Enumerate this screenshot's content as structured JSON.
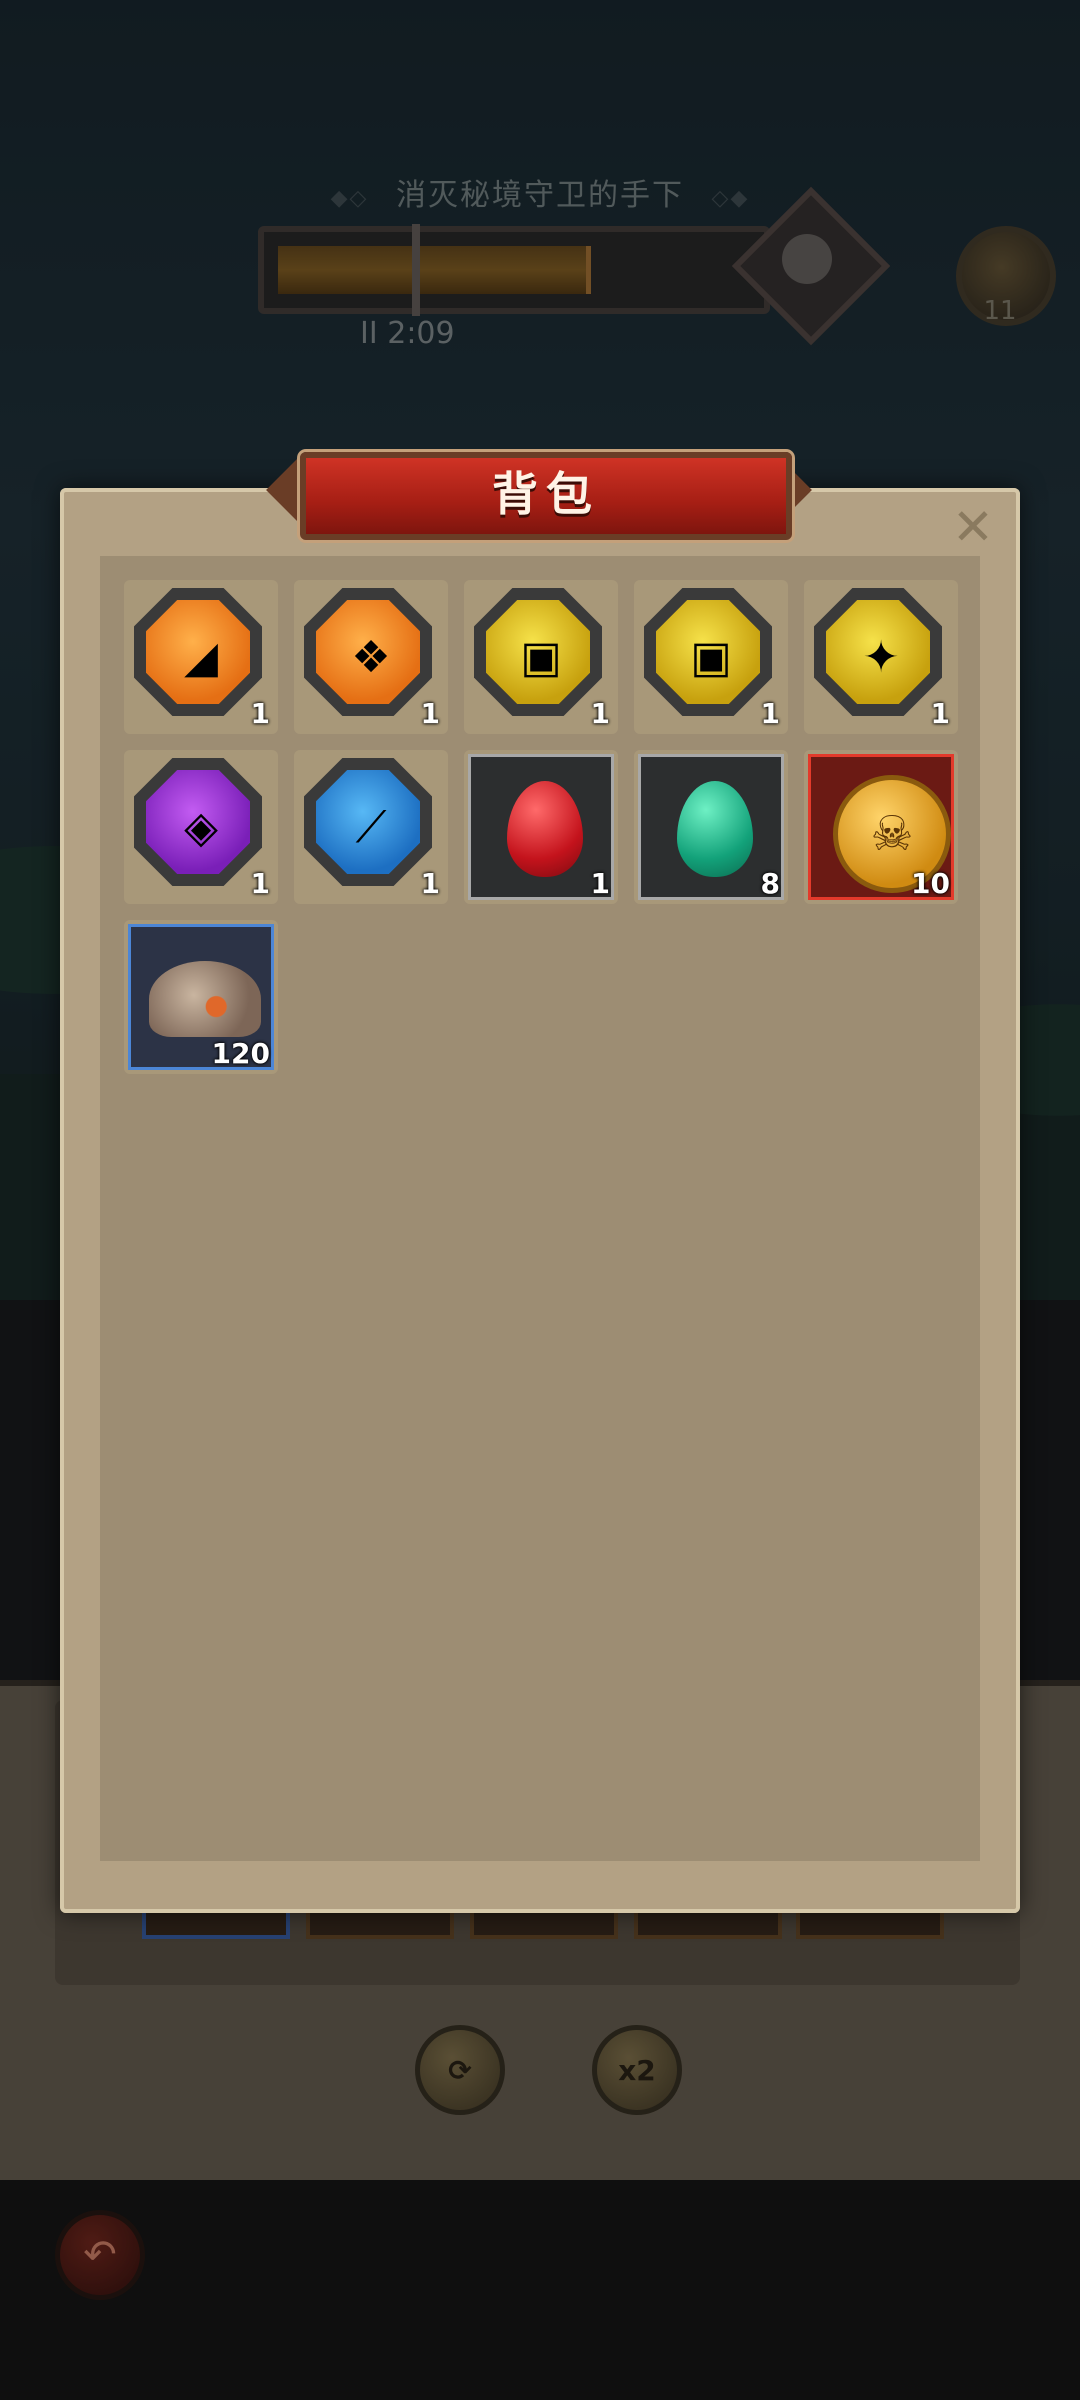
{
  "hud": {
    "mission_text": "消灭秘境守卫的手下",
    "deco_left": "◆◇",
    "deco_right": "◇◆",
    "timer": "II 2:09",
    "progress": 0.7,
    "chest_count": "11"
  },
  "modal": {
    "title": "背包",
    "close": "✕"
  },
  "bottom": {
    "refresh_glyph": "⟳",
    "speed_label": "x2",
    "back_glyph": "↶"
  },
  "items": [
    {
      "type": "badge",
      "color": "orange",
      "icon": "chest-armor-icon",
      "glyph": "◢",
      "qty": "1"
    },
    {
      "type": "badge",
      "color": "orange",
      "icon": "ornate-armor-icon",
      "glyph": "❖",
      "qty": "1"
    },
    {
      "type": "badge",
      "color": "yellow",
      "icon": "gauntlet-icon",
      "glyph": "▣",
      "qty": "1"
    },
    {
      "type": "badge",
      "color": "yellow",
      "icon": "gauntlet-icon",
      "glyph": "▣",
      "qty": "1"
    },
    {
      "type": "badge",
      "color": "yellow",
      "icon": "bone-icon",
      "glyph": "✦",
      "qty": "1"
    },
    {
      "type": "badge",
      "color": "purple",
      "icon": "amulet-icon",
      "glyph": "◈",
      "qty": "1"
    },
    {
      "type": "badge",
      "color": "blue",
      "icon": "dagger-icon",
      "glyph": "⟋",
      "qty": "1"
    },
    {
      "type": "egg",
      "color": "red",
      "icon": "red-gem-icon",
      "qty": "1"
    },
    {
      "type": "egg",
      "color": "green",
      "icon": "green-gem-icon",
      "qty": "8"
    },
    {
      "type": "coin",
      "color": "gold",
      "icon": "skull-coin-icon",
      "glyph": "☠",
      "qty": "10"
    },
    {
      "type": "rock",
      "color": "ore",
      "icon": "ore-pile-icon",
      "qty": "120"
    }
  ],
  "colors": {
    "banner": "#cf3325",
    "parchment": "#b3a184",
    "panel": "#9d8d73"
  }
}
